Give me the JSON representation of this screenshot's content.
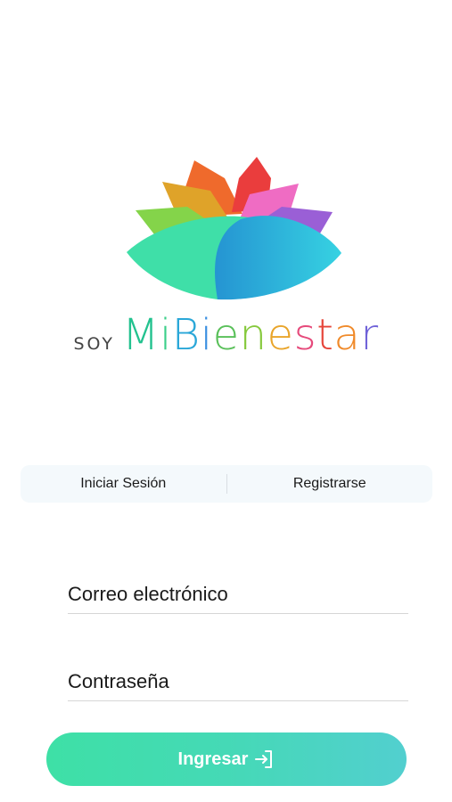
{
  "brand": {
    "prefix": "SOY",
    "letters": [
      {
        "ch": "M",
        "color": "#23c28f"
      },
      {
        "ch": "i",
        "color": "#3ccf8a"
      },
      {
        "ch": "B",
        "color": "#2aa7d8"
      },
      {
        "ch": "i",
        "color": "#3b8fe0"
      },
      {
        "ch": "e",
        "color": "#5ac05a"
      },
      {
        "ch": "n",
        "color": "#86c93c"
      },
      {
        "ch": "e",
        "color": "#e9a52b"
      },
      {
        "ch": "s",
        "color": "#e64a7b"
      },
      {
        "ch": "t",
        "color": "#e6453a"
      },
      {
        "ch": "a",
        "color": "#f08a2a"
      },
      {
        "ch": "r",
        "color": "#6f62d8"
      }
    ]
  },
  "tabs": {
    "login": "Iniciar Sesión",
    "register": "Registrarse"
  },
  "form": {
    "email_placeholder": "Correo electrónico",
    "password_placeholder": "Contraseña"
  },
  "button": {
    "label": "Ingresar",
    "icon": "login-arrow-icon"
  },
  "colors": {
    "button_gradient_start": "#3ee0a6",
    "button_gradient_end": "#52cfcf",
    "tab_background": "#f4f9fc"
  }
}
